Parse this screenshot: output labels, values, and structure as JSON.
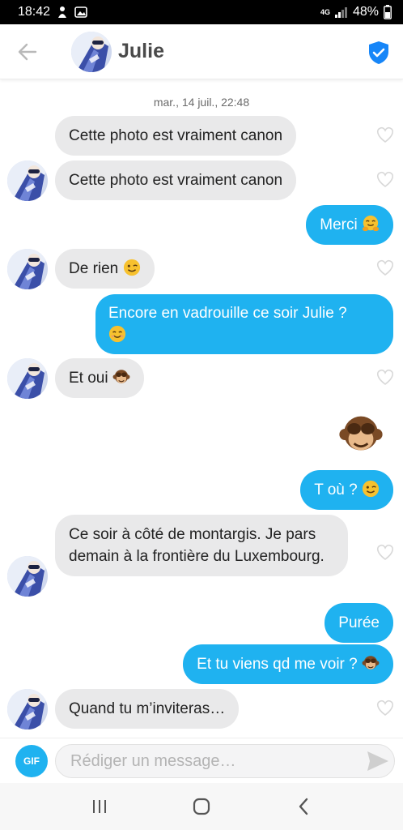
{
  "status_bar": {
    "time": "18:42",
    "network": "4G",
    "battery": "48%"
  },
  "header": {
    "contact_name": "Julie"
  },
  "chat": {
    "date": "mar., 14 juil., 22:48",
    "messages": [
      {
        "dir": "in",
        "text": "Cette photo est vraiment canon"
      },
      {
        "dir": "in",
        "text": "Cette photo est vraiment canon"
      },
      {
        "dir": "out",
        "text": "Merci",
        "emoji": "hugging-face"
      },
      {
        "dir": "in",
        "text": "De rien",
        "emoji": "winking-face"
      },
      {
        "dir": "out",
        "text": "Encore en vadrouille ce soir Julie ?",
        "emoji": "smiling-face"
      },
      {
        "dir": "in",
        "text": "Et oui",
        "emoji": "see-no-evil-monkey"
      },
      {
        "dir": "out",
        "text": "",
        "emoji": "see-no-evil-monkey-large"
      },
      {
        "dir": "out",
        "text": "T où ?",
        "emoji": "winking-face"
      },
      {
        "dir": "in",
        "text": "Ce soir à côté de montargis. Je pars demain à la frontière du Luxembourg."
      },
      {
        "dir": "out",
        "text": "Purée"
      },
      {
        "dir": "out",
        "text": "Et tu viens qd me voir ?",
        "emoji": "see-no-evil-monkey"
      },
      {
        "dir": "in",
        "text": "Quand tu m’inviteras…"
      }
    ]
  },
  "input": {
    "gif_label": "GIF",
    "placeholder": "Rédiger un message…"
  },
  "colors": {
    "accent": "#1fb2f0",
    "incoming_bubble": "#e9e9ea",
    "shield": "#1786f8"
  }
}
